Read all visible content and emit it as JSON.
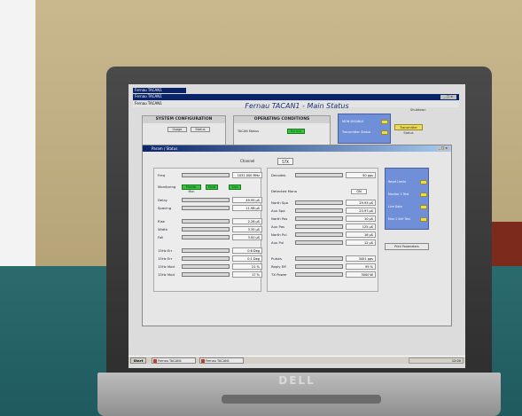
{
  "window": {
    "outer_title": "Fernau TACAN1",
    "app_caption": "Fernau TACAN1",
    "menu_text": "Fernau TACAN1",
    "app_title": "Fernau TACAN1 - Main Status",
    "right_menu": "Shutdown",
    "min_text": "_ □ ×"
  },
  "system_configuration": {
    "title": "SYSTEM CONFIGURATION",
    "buttons": [
      "Usage",
      "Status"
    ]
  },
  "operating_conditions": {
    "title": "OPERATING CONDITIONS",
    "label": "TACAN Status",
    "status": "Normal"
  },
  "blue_top": {
    "rows": [
      "MON DISABLE",
      "Transmitter Status"
    ]
  },
  "yellow_badge": "Transmitter Status",
  "param_window": {
    "title": "Param / Status",
    "close_text": "_ □ ×",
    "channel_label": "Channel",
    "channel_value": "57X",
    "left_rows": [
      {
        "label": "Freq",
        "value": "1031.000 MHz",
        "fill": 0.95,
        "yellow": false
      },
      {
        "label": "Delay",
        "value": "49.95 µS",
        "fill": 0.9,
        "yellow": false
      },
      {
        "label": "Spacing",
        "value": "11.98 µS",
        "fill": 0.9,
        "yellow": false
      },
      {
        "label": "Rise",
        "value": "2.28 µS",
        "fill": 0.9,
        "yellow": false
      },
      {
        "label": "Width",
        "value": "3.35 µS",
        "fill": 0.9,
        "yellow": false
      },
      {
        "label": "Fall",
        "value": "3.00 µS",
        "fill": 0.9,
        "yellow": false
      },
      {
        "label": "15Hz Err",
        "value": "0.6 Deg",
        "fill": 0.9,
        "yellow": false
      },
      {
        "label": "15Hz Err",
        "value": "0.1 Deg",
        "fill": 0.9,
        "yellow": false
      },
      {
        "label": "15Hz Mod",
        "value": "21 %",
        "fill": 0.9,
        "yellow": false
      },
      {
        "label": "15Hz Mod",
        "value": "17 %",
        "fill": 0.9,
        "yellow": false
      }
    ],
    "monitoring": {
      "label": "Monitoring",
      "chips": [
        "Mainte. Mon",
        "Fault",
        "Live"
      ]
    },
    "right_rows": [
      {
        "label": "Decodes",
        "value": "50 pps",
        "fill": 0.8,
        "yellow": true
      },
      {
        "label": "North Spa",
        "value": "29.93 µS",
        "fill": 0.9,
        "yellow": true
      },
      {
        "label": "Aux Spa",
        "value": "23.97 µS",
        "fill": 0.9,
        "yellow": true
      },
      {
        "label": "North Pos",
        "value": "10 µS",
        "fill": 0.9,
        "yellow": true
      },
      {
        "label": "Aux Pos",
        "value": "125 µS",
        "fill": 0.9,
        "yellow": true
      },
      {
        "label": "North Pul",
        "value": "16 µS",
        "fill": 0.9,
        "yellow": false
      },
      {
        "label": "Aux Pul",
        "value": "12 µS",
        "fill": 0.9,
        "yellow": false
      },
      {
        "label": "Pulses",
        "value": "3451 pps",
        "fill": 0.85,
        "yellow": true
      },
      {
        "label": "Reply Eff",
        "value": "95 %",
        "fill": 0.9,
        "yellow": false
      },
      {
        "label": "TX Power",
        "value": "3000 W",
        "fill": 0.9,
        "yellow": false
      }
    ],
    "detected_mode": {
      "label": "Detected Mono",
      "value": "ON"
    },
    "side_panel": [
      "Reset Limits",
      "Monitor 1 Test",
      "Live Data",
      "Mon 1 Self Test"
    ],
    "print_button": "Print Parameters"
  },
  "taskbar": {
    "start": "Start",
    "tasks": [
      "Fernau TACAN1",
      "Fernau TACAN1"
    ],
    "tray": "12:00"
  },
  "brand": "DELL"
}
